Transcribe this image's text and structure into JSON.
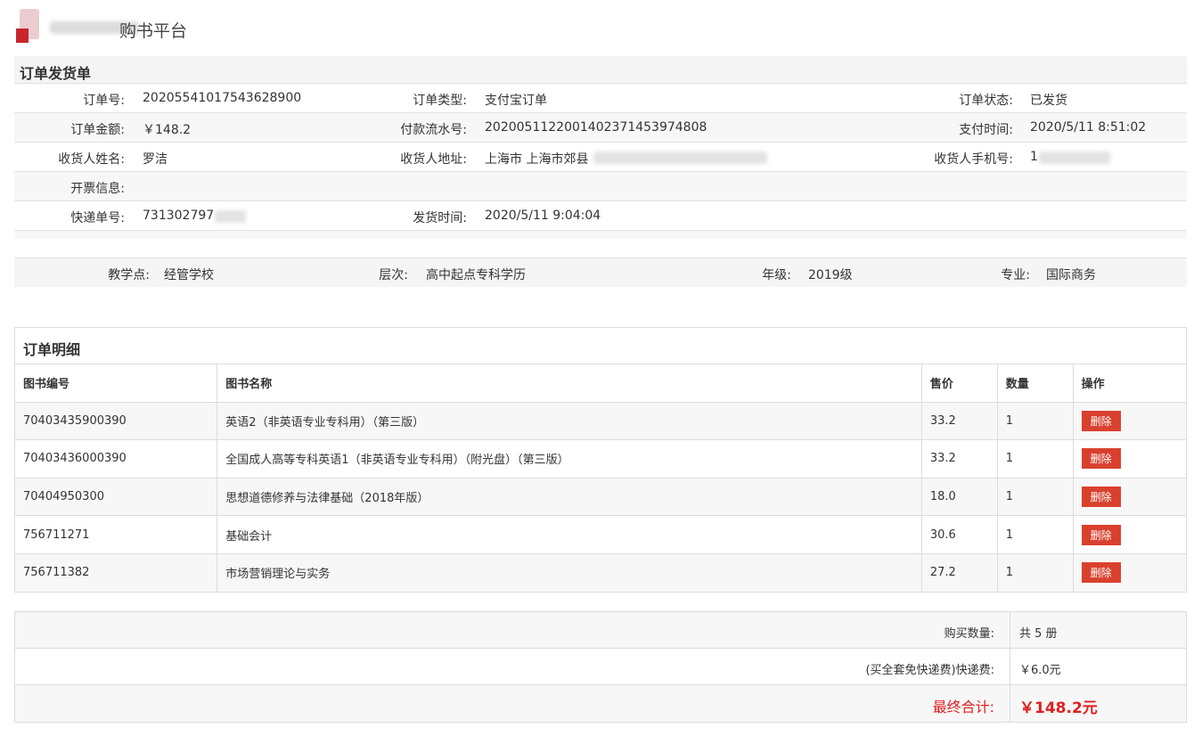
{
  "header": {
    "brand_text": "购书平台",
    "logo_icon": "brand-logo-icon"
  },
  "shipping": {
    "title": "订单发货单",
    "rows": [
      {
        "l1": "订单号:",
        "v1": "20205541017543628900",
        "l2": "订单类型:",
        "v2": "支付宝订单",
        "l3": "订单状态:",
        "v3": "已发货"
      },
      {
        "l1": "订单金额:",
        "v1": "￥148.2",
        "l2": "付款流水号:",
        "v2": "2020051122001402371453974808",
        "l3": "支付时间:",
        "v3": "2020/5/11 8:51:02"
      },
      {
        "l1": "收货人姓名:",
        "v1": "罗洁",
        "l2": "收货人地址:",
        "v2": "上海市 上海市郊县",
        "l3": "收货人手机号:",
        "v3": "1"
      },
      {
        "l1": "开票信息:",
        "v1": ""
      },
      {
        "l1": "快递单号:",
        "v1": "731302797",
        "l2": "发货时间:",
        "v2": "2020/5/11 9:04:04"
      }
    ]
  },
  "student": {
    "school_label": "教学点:",
    "school": "经管学校",
    "level_label": "层次:",
    "level": "高中起点专科学历",
    "grade_label": "年级:",
    "grade": "2019级",
    "major_label": "专业:",
    "major": "国际商务"
  },
  "detail": {
    "title": "订单明细",
    "headers": [
      "图书编号",
      "图书名称",
      "售价",
      "数量",
      "操作"
    ],
    "delete_label": "删除",
    "rows": [
      {
        "id": "70403435900390",
        "name": "英语2（非英语专业专科用）（第三版）",
        "price": "33.2",
        "qty": "1"
      },
      {
        "id": "70403436000390",
        "name": "全国成人高等专科英语1（非英语专业专科用）（附光盘）（第三版）",
        "price": "33.2",
        "qty": "1"
      },
      {
        "id": "70404950300",
        "name": "思想道德修养与法律基础（2018年版）",
        "price": "18.0",
        "qty": "1"
      },
      {
        "id": "756711271",
        "name": "基础会计",
        "price": "30.6",
        "qty": "1"
      },
      {
        "id": "756711382",
        "name": "市场营销理论与实务",
        "price": "27.2",
        "qty": "1"
      }
    ]
  },
  "summary": {
    "qty_label": "购买数量:",
    "qty_value": "共 5 册",
    "shipping_label": "(买全套免快递费)快递费:",
    "shipping_value": "￥6.0元",
    "total_label": "最终合计:",
    "total_value": "￥148.2元"
  },
  "colors": {
    "accent_red": "#e02020",
    "delete_button": "#d9412e",
    "row_shade": "#f7f7f7"
  }
}
